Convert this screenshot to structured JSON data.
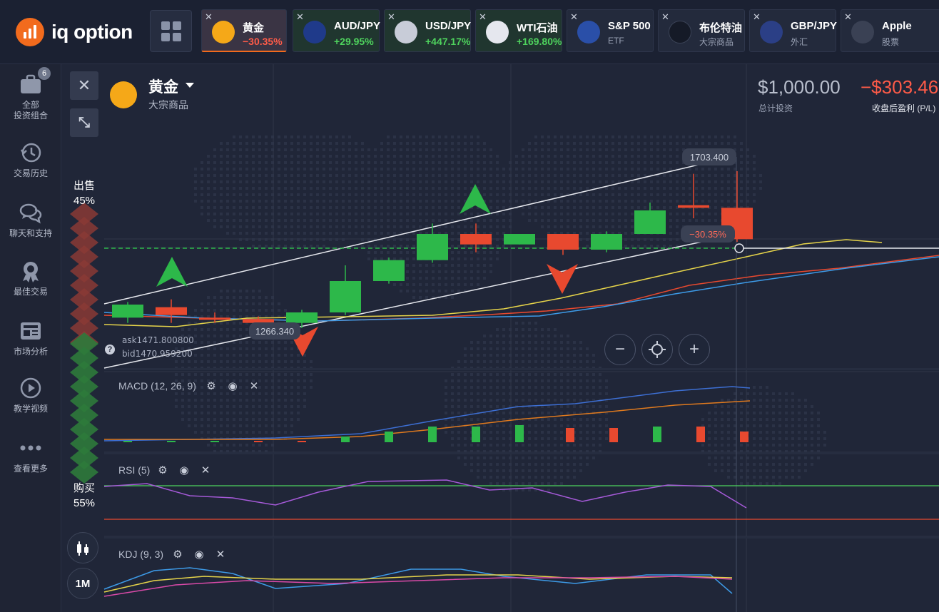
{
  "app": {
    "logo_text": "iq option"
  },
  "tabs": [
    {
      "name": "黄金",
      "value": "−30.35%",
      "trend": "neg",
      "icon": "gold-icon",
      "active": true
    },
    {
      "name": "AUD/JPY",
      "value": "+29.95%",
      "trend": "pos",
      "icon": "aud-jpy-flag-icon"
    },
    {
      "name": "USD/JPY",
      "value": "+447.17%",
      "trend": "pos",
      "icon": "usd-jpy-flag-icon"
    },
    {
      "name": "WTI石油",
      "value": "+169.80%",
      "trend": "pos",
      "icon": "oil-drop-icon"
    },
    {
      "name": "S&P 500 E",
      "sub": "ETF",
      "icon": "spy-icon"
    },
    {
      "name": "布伦特油",
      "sub": "大宗商品",
      "icon": "brent-drop-icon"
    },
    {
      "name": "GBP/JPY",
      "sub": "外汇",
      "icon": "gbp-jpy-flag-icon"
    },
    {
      "name": "Apple",
      "sub": "股票",
      "icon": "apple-icon"
    }
  ],
  "sidebar": {
    "portfolio_badge": "6",
    "items": [
      {
        "label1": "全部",
        "label2": "投资组合"
      },
      {
        "label1": "交易历史"
      },
      {
        "label1": "聊天和支持"
      },
      {
        "label1": "最佳交易"
      },
      {
        "label1": "市场分析"
      },
      {
        "label1": "教学视频"
      },
      {
        "label1": "查看更多"
      }
    ]
  },
  "asset": {
    "title": "黄金",
    "subtitle": "大宗商品"
  },
  "summary": {
    "investment": "$1,000.00",
    "investment_label": "总计投资",
    "pl": "−$303.46",
    "pl_label": "收盘后盈利 (P/L)"
  },
  "sentiment": {
    "sell_label": "出售",
    "sell_pct": "45%",
    "buy_label": "购买",
    "buy_pct": "55%"
  },
  "chart_labels": {
    "high": "1703.400",
    "low": "1266.340",
    "current_change": "−30.35%",
    "ask": "ask1471.800800",
    "bid": "bid1470.959200",
    "help": "?"
  },
  "indicators": {
    "macd": "MACD (12, 26, 9)",
    "rsi": "RSI (5)",
    "kdj": "KDJ (9, 3)"
  },
  "controls": {
    "timeframe": "1M",
    "zoom_out": "−",
    "zoom_in": "+",
    "close": "✕",
    "collapse": "⤡"
  },
  "colors": {
    "up": "#2db84a",
    "down": "#e8492f",
    "accent": "#f26b1d",
    "gold": "#f5a818"
  },
  "chart_data": {
    "type": "candlestick",
    "candles": [
      {
        "o": 0.54,
        "c": 0.59,
        "h": 0.6,
        "l": 0.52
      },
      {
        "o": 0.58,
        "c": 0.55,
        "h": 0.61,
        "l": 0.52
      },
      {
        "o": 0.54,
        "c": 0.535,
        "h": 0.56,
        "l": 0.52
      },
      {
        "o": 0.535,
        "c": 0.52,
        "h": 0.545,
        "l": 0.5
      },
      {
        "o": 0.52,
        "c": 0.56,
        "h": 0.57,
        "l": 0.5
      },
      {
        "o": 0.56,
        "c": 0.68,
        "h": 0.74,
        "l": 0.55
      },
      {
        "o": 0.68,
        "c": 0.76,
        "h": 0.77,
        "l": 0.67
      },
      {
        "o": 0.76,
        "c": 0.86,
        "h": 0.9,
        "l": 0.75
      },
      {
        "o": 0.86,
        "c": 0.82,
        "h": 0.9,
        "l": 0.79
      },
      {
        "o": 0.82,
        "c": 0.86,
        "h": 0.86,
        "l": 0.82
      },
      {
        "o": 0.86,
        "c": 0.8,
        "h": 0.86,
        "l": 0.78
      },
      {
        "o": 0.8,
        "c": 0.86,
        "h": 0.87,
        "l": 0.79
      },
      {
        "o": 0.86,
        "c": 0.95,
        "h": 0.98,
        "l": 0.86
      },
      {
        "o": 0.97,
        "c": 0.96,
        "h": 1.09,
        "l": 0.92
      },
      {
        "o": 0.96,
        "c": 0.84,
        "h": 1.1,
        "l": 0.83
      }
    ],
    "macd_hist": [
      0.02,
      0.02,
      0.02,
      -0.02,
      -0.02,
      0.08,
      0.15,
      0.22,
      0.22,
      0.24,
      -0.2,
      -0.2,
      0.22,
      -0.22,
      -0.15
    ]
  }
}
